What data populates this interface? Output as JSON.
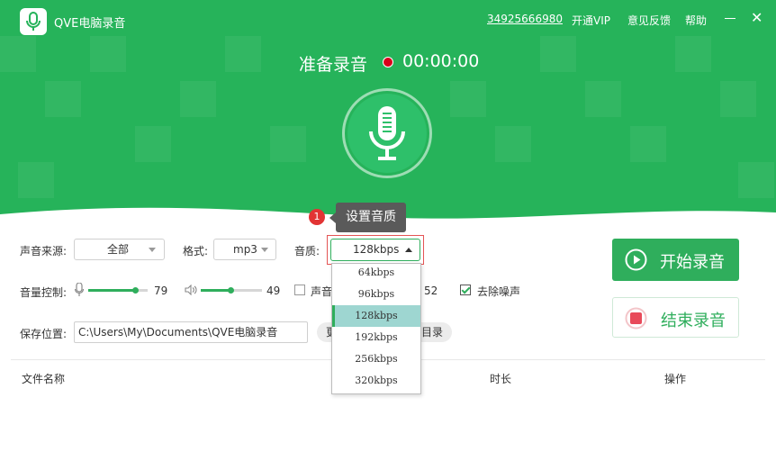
{
  "app": {
    "title": "QVE电脑录音"
  },
  "topnav": {
    "phone": "34925666980",
    "vip": "开通VIP",
    "feedback": "意见反馈",
    "help": "帮助"
  },
  "window": {
    "minimize": "—",
    "close": "✕"
  },
  "status": {
    "label": "准备录音",
    "timer": "00:00:00"
  },
  "tooltip": {
    "badge": "1",
    "text": "设置音质"
  },
  "controls": {
    "source_label": "声音来源:",
    "source_value": "全部",
    "format_label": "格式:",
    "format_value": "mp3",
    "quality_label": "音质:",
    "quality_value": "128kbps",
    "volume_label": "音量控制:",
    "mic_volume": "79",
    "speaker_volume": "49",
    "hidden_value": "52",
    "sound_checkbox_label": "声音",
    "denoise_label": "去除噪声",
    "save_label": "保存位置:",
    "save_path": "C:\\Users\\My\\Documents\\QVE电脑录音",
    "browse_partial": "更",
    "open_dir_partial": "目录"
  },
  "slider_levels": {
    "mic": 0.79,
    "speaker": 0.49
  },
  "quality_options": [
    "64kbps",
    "96kbps",
    "128kbps",
    "192kbps",
    "256kbps",
    "320kbps"
  ],
  "buttons": {
    "start": "开始录音",
    "stop": "结束录音"
  },
  "table": {
    "headers": {
      "name": "文件名称",
      "duration": "时长",
      "actions": "操作"
    }
  },
  "colors": {
    "brand": "#26b35a",
    "accent": "#2fae5c",
    "record_dot": "#d8001a",
    "stop_red": "#e84a5a",
    "selected_option": "#9ed6d1"
  }
}
